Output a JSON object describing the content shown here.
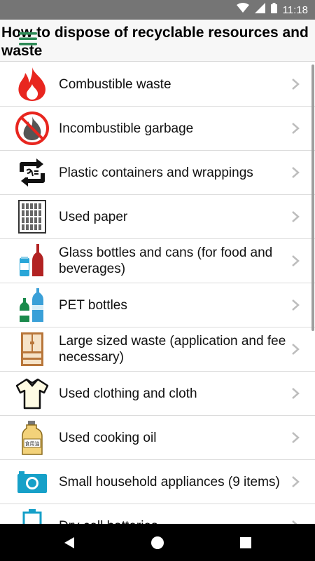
{
  "status_bar": {
    "time": "11:18",
    "icons": [
      "wifi-icon",
      "signal-icon",
      "battery-icon"
    ]
  },
  "header": {
    "title": "How to dispose of recyclable resources and waste",
    "menu_icon": "hamburger-menu-icon"
  },
  "items": [
    {
      "label": "Combustible waste",
      "icon": "fire-icon"
    },
    {
      "label": "Incombustible garbage",
      "icon": "no-fire-icon"
    },
    {
      "label": "Plastic containers and wrappings",
      "icon": "plastic-recycle-icon"
    },
    {
      "label": "Used paper",
      "icon": "paper-icon"
    },
    {
      "label": "Glass bottles and cans (for food and beverages)",
      "icon": "bottles-cans-icon"
    },
    {
      "label": "PET bottles",
      "icon": "pet-bottle-icon"
    },
    {
      "label": "Large sized waste (application and fee necessary)",
      "icon": "cabinet-icon"
    },
    {
      "label": "Used clothing and cloth",
      "icon": "shirt-icon"
    },
    {
      "label": "Used cooking oil",
      "icon": "oil-bottle-icon"
    },
    {
      "label": "Small household appliances (9 items)",
      "icon": "camera-icon"
    },
    {
      "label": "Dry cell batteries",
      "icon": "battery-cell-icon"
    }
  ],
  "cooking_oil_label": "食用油",
  "nav": {
    "back": "back-icon",
    "home": "home-icon",
    "recents": "recents-icon"
  },
  "colors": {
    "status_bar": "#757575",
    "header_bg": "#f7f7f7",
    "fire_red": "#e8261f",
    "menu_green": "#2e8b57"
  }
}
